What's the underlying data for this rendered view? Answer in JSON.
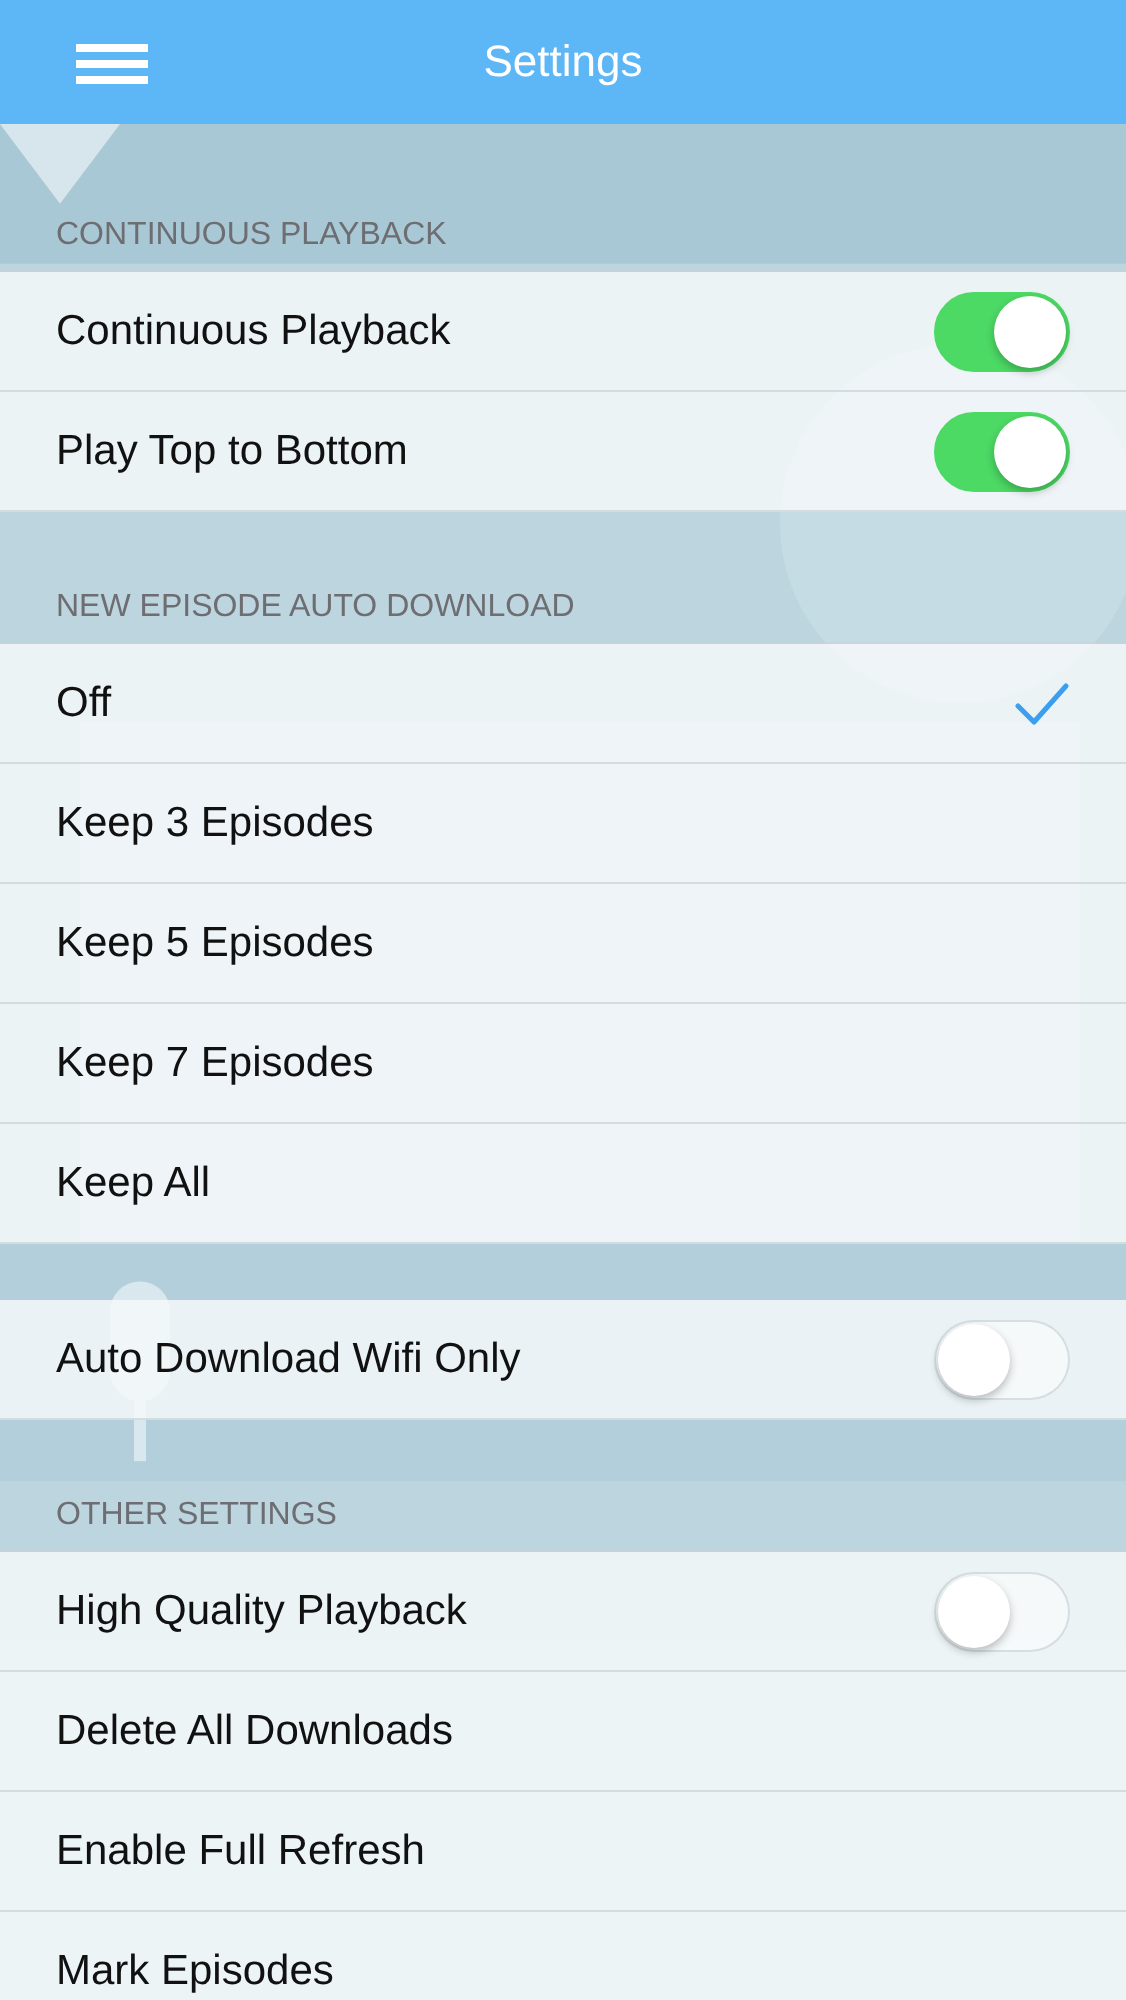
{
  "header": {
    "title": "Settings"
  },
  "sections": [
    {
      "title": "CONTINUOUS PLAYBACK",
      "rows": [
        {
          "kind": "toggle",
          "label": "Continuous Playback",
          "on": true
        },
        {
          "kind": "toggle",
          "label": "Play Top to Bottom",
          "on": true
        }
      ]
    },
    {
      "title": "NEW EPISODE AUTO DOWNLOAD",
      "rows": [
        {
          "kind": "choice",
          "label": "Off",
          "selected": true
        },
        {
          "kind": "choice",
          "label": "Keep 3 Episodes",
          "selected": false
        },
        {
          "kind": "choice",
          "label": "Keep 5 Episodes",
          "selected": false
        },
        {
          "kind": "choice",
          "label": "Keep 7 Episodes",
          "selected": false
        },
        {
          "kind": "choice",
          "label": "Keep All",
          "selected": false
        }
      ]
    },
    {
      "rows": [
        {
          "kind": "toggle",
          "label": "Auto Download Wifi Only",
          "on": false
        }
      ]
    },
    {
      "title": "OTHER SETTINGS",
      "rows": [
        {
          "kind": "toggle",
          "label": "High Quality Playback",
          "on": false
        },
        {
          "kind": "action",
          "label": "Delete All Downloads"
        },
        {
          "kind": "action",
          "label": "Enable Full Refresh"
        },
        {
          "kind": "action",
          "label": "Mark Episodes"
        }
      ]
    }
  ]
}
